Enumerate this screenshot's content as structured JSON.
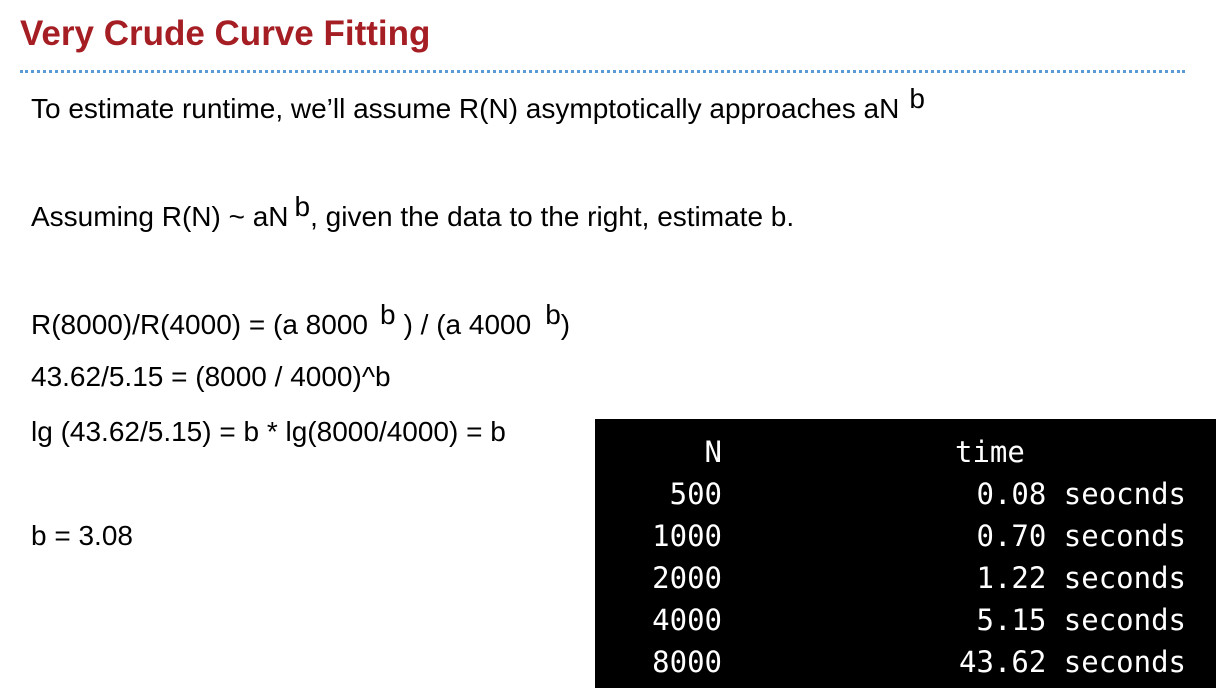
{
  "slide": {
    "title": "Very Crude Curve Fitting",
    "line1": {
      "text": "To estimate runtime, we’ll assume R(N) asymptotically approaches  aN",
      "exp": "b"
    },
    "line2": {
      "pre": "Assuming R(N) ~ aN",
      "exp": "b",
      "post": ", given the data to the right, estimate b."
    },
    "line3": {
      "part1": "R(8000)/R(4000) = (a 8000",
      "exp1": "b",
      "part2": ")  /  (a 4000",
      "exp2": "b",
      "part3": ")"
    },
    "line4": "43.62/5.15 = (8000 / 4000)^b",
    "line5": "lg (43.62/5.15) = b * lg(8000/4000) = b",
    "answer": "b = 3.08"
  },
  "terminal": {
    "colors": {
      "background": "#000000",
      "text": "#ffffff"
    },
    "headers": {
      "n": "N",
      "time": "time"
    },
    "rows": [
      {
        "n": "500",
        "time": "0.08 seocnds"
      },
      {
        "n": "1000",
        "time": "0.70 seconds"
      },
      {
        "n": "2000",
        "time": "1.22 seconds"
      },
      {
        "n": "4000",
        "time": "5.15 seconds"
      },
      {
        "n": "8000",
        "time": "43.62 seconds"
      }
    ]
  },
  "theme": {
    "title_color": "#a51e24",
    "divider_color": "#5b9bd5"
  }
}
